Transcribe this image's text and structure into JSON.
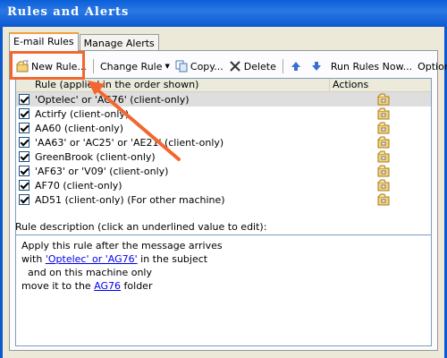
{
  "window": {
    "title": "Rules and Alerts"
  },
  "tabs": [
    {
      "label": "E-mail Rules",
      "active": true
    },
    {
      "label": "Manage Alerts",
      "active": false
    }
  ],
  "toolbar": {
    "new_rule": "New Rule...",
    "change_rule": "Change Rule",
    "copy": "Copy...",
    "delete": "Delete",
    "run_rules_now": "Run Rules Now...",
    "options": "Options"
  },
  "rules_list": {
    "header_rule": "Rule (applied in the order shown)",
    "header_actions": "Actions",
    "rows": [
      {
        "label": "'Optelec' or 'AG76' (client-only)",
        "checked": true,
        "selected": true
      },
      {
        "label": "Actirfy  (client-only)",
        "checked": true
      },
      {
        "label": "AA60  (client-only)",
        "checked": true
      },
      {
        "label": "'AA63' or 'AC25' or 'AE21'  (client-only)",
        "checked": true
      },
      {
        "label": "GreenBrook  (client-only)",
        "checked": true
      },
      {
        "label": "'AF63' or 'V09'  (client-only)",
        "checked": true
      },
      {
        "label": "AF70  (client-only)",
        "checked": true
      },
      {
        "label": "AD51  (client-only)  (For other machine)",
        "checked": true
      }
    ]
  },
  "description": {
    "label": "Rule description (click an underlined value to edit):",
    "line1": "Apply this rule after the message arrives",
    "line2_prefix": "with ",
    "line2_link": "'Optelec' or 'AG76'",
    "line2_suffix": " in the subject",
    "line3": "  and on this machine only",
    "line4_prefix": "move it to the ",
    "line4_link": "AG76",
    "line4_suffix": " folder"
  },
  "colors": {
    "titlebar": "#0a5fd8",
    "annotation": "#f2672f",
    "link": "#0000ee"
  },
  "icons": [
    "new-rule-icon",
    "change-rule-icon",
    "copy-icon",
    "delete-icon",
    "move-up-icon",
    "move-down-icon",
    "rule-action-icon"
  ]
}
